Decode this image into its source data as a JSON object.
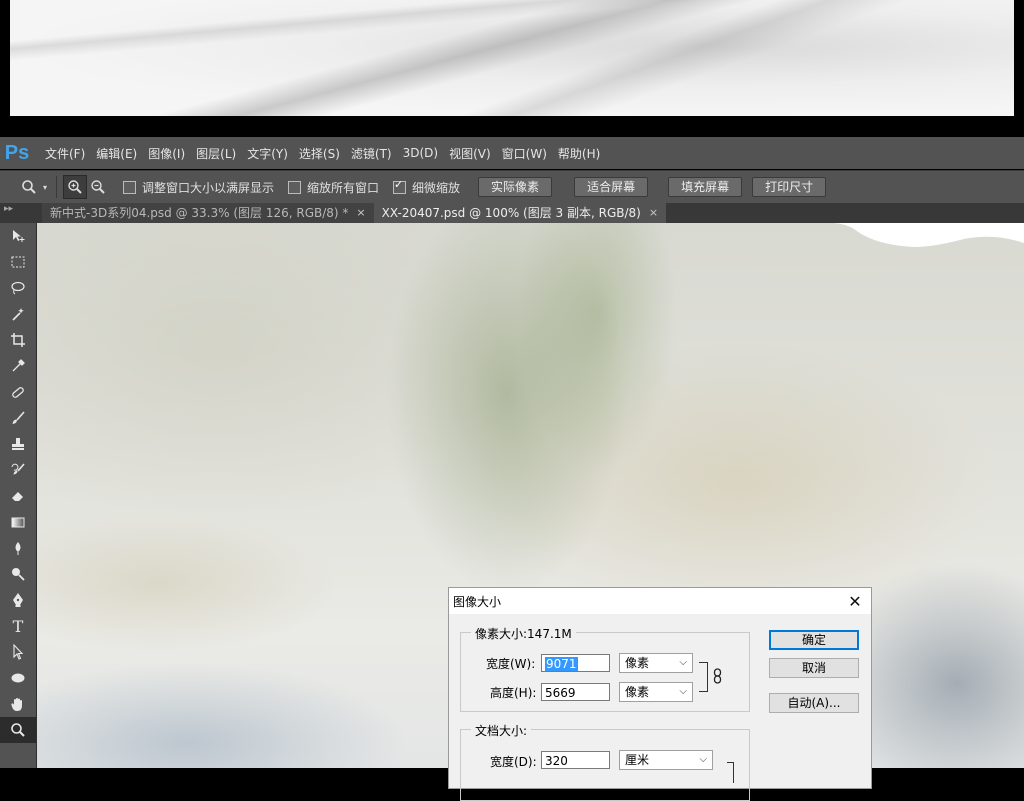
{
  "app": {
    "logo": "Ps"
  },
  "menu": [
    "文件(F)",
    "编辑(E)",
    "图像(I)",
    "图层(L)",
    "文字(Y)",
    "选择(S)",
    "滤镜(T)",
    "3D(D)",
    "视图(V)",
    "窗口(W)",
    "帮助(H)"
  ],
  "options": {
    "checkboxes": [
      {
        "label": "调整窗口大小以满屏显示",
        "checked": false
      },
      {
        "label": "缩放所有窗口",
        "checked": false
      },
      {
        "label": "细微缩放",
        "checked": true
      }
    ],
    "buttons": [
      "实际像素",
      "适合屏幕",
      "填充屏幕",
      "打印尺寸"
    ]
  },
  "tabs": [
    {
      "title": "新中式-3D系列04.psd @ 33.3% (图层 126, RGB/8) *",
      "close": "×",
      "active": false
    },
    {
      "title": "XX-20407.psd @ 100% (图层 3 副本, RGB/8)",
      "close": "×",
      "active": true
    }
  ],
  "tools": [
    "move-icon",
    "marquee-icon",
    "lasso-icon",
    "magic-wand-icon",
    "crop-icon",
    "eyedropper-icon",
    "healing-brush-icon",
    "brush-icon",
    "stamp-icon",
    "history-brush-icon",
    "eraser-icon",
    "gradient-icon",
    "blur-icon",
    "dodge-icon",
    "pen-icon",
    "type-icon",
    "path-select-icon",
    "ellipse-icon",
    "hand-icon",
    "zoom-icon"
  ],
  "dialog": {
    "title": "图像大小",
    "close": "✕",
    "pixel_size_label": "像素大小:147.1M",
    "width_label": "宽度(W):",
    "width_value": "9071",
    "width_unit": "像素",
    "height_label": "高度(H):",
    "height_value": "5669",
    "height_unit": "像素",
    "doc_size_label": "文档大小:",
    "doc_width_label": "宽度(D):",
    "doc_width_value": "320",
    "doc_width_unit": "厘米",
    "ok": "确定",
    "cancel": "取消",
    "auto": "自动(A)..."
  }
}
